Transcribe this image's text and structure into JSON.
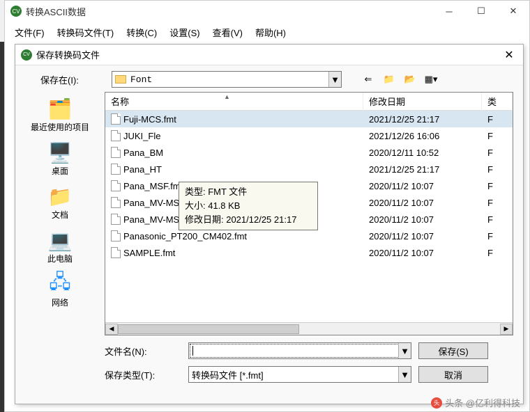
{
  "main": {
    "title": "转换ASCII数据",
    "menu": [
      "文件(F)",
      "转换码文件(T)",
      "转换(C)",
      "设置(S)",
      "查看(V)",
      "帮助(H)"
    ]
  },
  "dialog": {
    "title": "保存转换码文件",
    "savein_label": "保存在(I):",
    "savein_value": "Font",
    "headers": {
      "name": "名称",
      "date": "修改日期",
      "type": "类"
    },
    "files": [
      {
        "name": "Fuji-MCS.fmt",
        "date": "2021/12/25 21:17",
        "type": "F",
        "sel": true
      },
      {
        "name": "JUKI_Fle",
        "date": "2021/12/26 16:06",
        "type": "F"
      },
      {
        "name": "Pana_BM",
        "date": "2020/12/11 10:52",
        "type": "F"
      },
      {
        "name": "Pana_HT",
        "date": "2021/12/25 21:17",
        "type": "F"
      },
      {
        "name": "Pana_MSF.fmt",
        "date": "2020/11/2 10:07",
        "type": "F"
      },
      {
        "name": "Pana_MV-MS-MPA_BRD.fmt",
        "date": "2020/11/2 10:07",
        "type": "F"
      },
      {
        "name": "Pana_MV-MS-MPA_POS_SET.fmt",
        "date": "2020/11/2 10:07",
        "type": "F"
      },
      {
        "name": "Panasonic_PT200_CM402.fmt",
        "date": "2020/11/2 10:07",
        "type": "F"
      },
      {
        "name": "SAMPLE.fmt",
        "date": "2020/11/2 10:07",
        "type": "F"
      }
    ],
    "tooltip": {
      "line1": "类型: FMT 文件",
      "line2": "大小: 41.8 KB",
      "line3": "修改日期: 2021/12/25 21:17"
    },
    "places": [
      "最近使用的项目",
      "桌面",
      "文档",
      "此电脑",
      "网络"
    ],
    "filename_label": "文件名(N):",
    "filename_value": "",
    "filetype_label": "保存类型(T):",
    "filetype_value": "转换码文件 [*.fmt]",
    "save_btn": "保存(S)",
    "cancel_btn": "取消"
  },
  "watermark": "头条 @亿利得科技"
}
